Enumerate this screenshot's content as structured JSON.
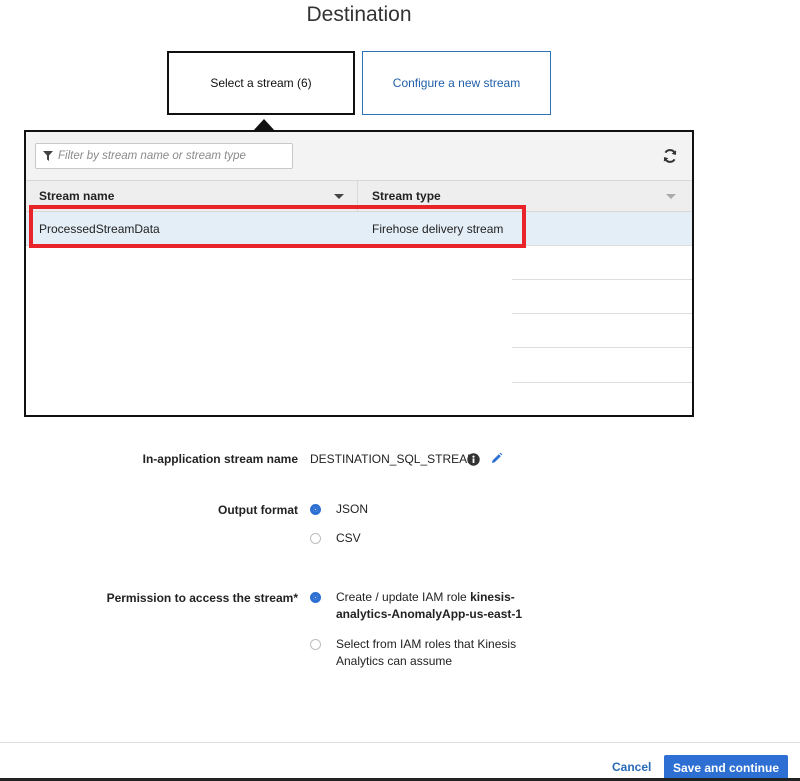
{
  "page": {
    "title": "Destination"
  },
  "segments": {
    "select_stream": "Select a stream (6)",
    "configure_stream": "Configure a new stream"
  },
  "filter": {
    "placeholder": "Filter by stream name or stream type"
  },
  "table": {
    "columns": [
      "Stream name",
      "Stream type"
    ],
    "rows": [
      {
        "name": "ProcessedStreamData",
        "type": "Firehose delivery stream",
        "selected": true
      }
    ]
  },
  "form": {
    "stream_name_label": "In-application stream name",
    "stream_name_value": "DESTINATION_SQL_STREAM",
    "output_format_label": "Output format",
    "output_options": [
      "JSON",
      "CSV"
    ],
    "output_selected": "JSON",
    "permission_label": "Permission to access the stream*",
    "permission_option1_prefix": "Create / update IAM role ",
    "permission_option1_role_line1": "kinesis-",
    "permission_option1_role_line2": "analytics-AnomalyApp-us-east-1",
    "permission_option2_line1": "Select from IAM roles that Kinesis",
    "permission_option2_line2": "Analytics can assume",
    "permission_selected": 0
  },
  "footer": {
    "cancel": "Cancel",
    "save": "Save and continue"
  },
  "colors": {
    "accent": "#2d6fd2",
    "highlight": "#e8232a",
    "selected_row": "#e4eef7"
  }
}
